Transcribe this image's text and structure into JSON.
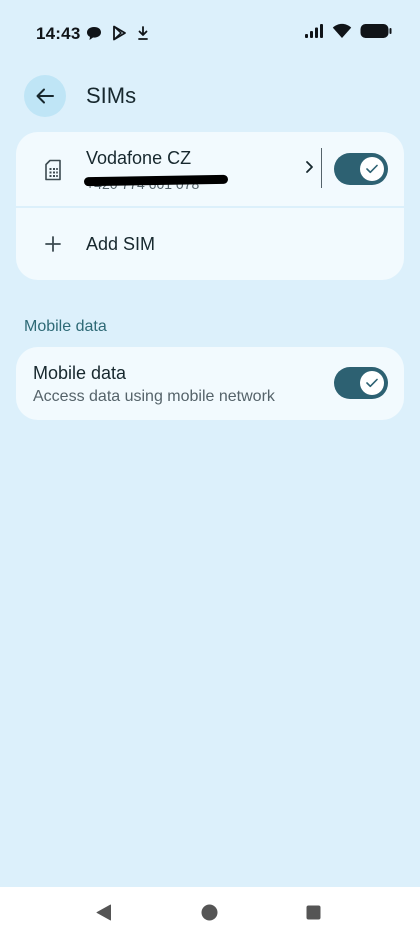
{
  "status_bar": {
    "time": "14:43",
    "left_icons": [
      "chat-bubble-icon",
      "play-store-icon",
      "download-icon"
    ],
    "right_icons": [
      "cellular-signal-icon",
      "wifi-icon",
      "battery-icon"
    ]
  },
  "header": {
    "back_icon": "arrow-back-icon",
    "title": "SIMs"
  },
  "sims": {
    "items": [
      {
        "name": "Vodafone CZ",
        "number": "+420 774 601 078",
        "icon": "sim-card-icon",
        "enabled": true
      }
    ],
    "add_label": "Add SIM",
    "add_icon": "plus-icon"
  },
  "mobile_data_section": {
    "header": "Mobile data",
    "title": "Mobile data",
    "summary": "Access data using mobile network",
    "enabled": true
  },
  "nav_bar": {
    "buttons": [
      "back-triangle-icon",
      "home-circle-icon",
      "recents-square-icon"
    ]
  }
}
